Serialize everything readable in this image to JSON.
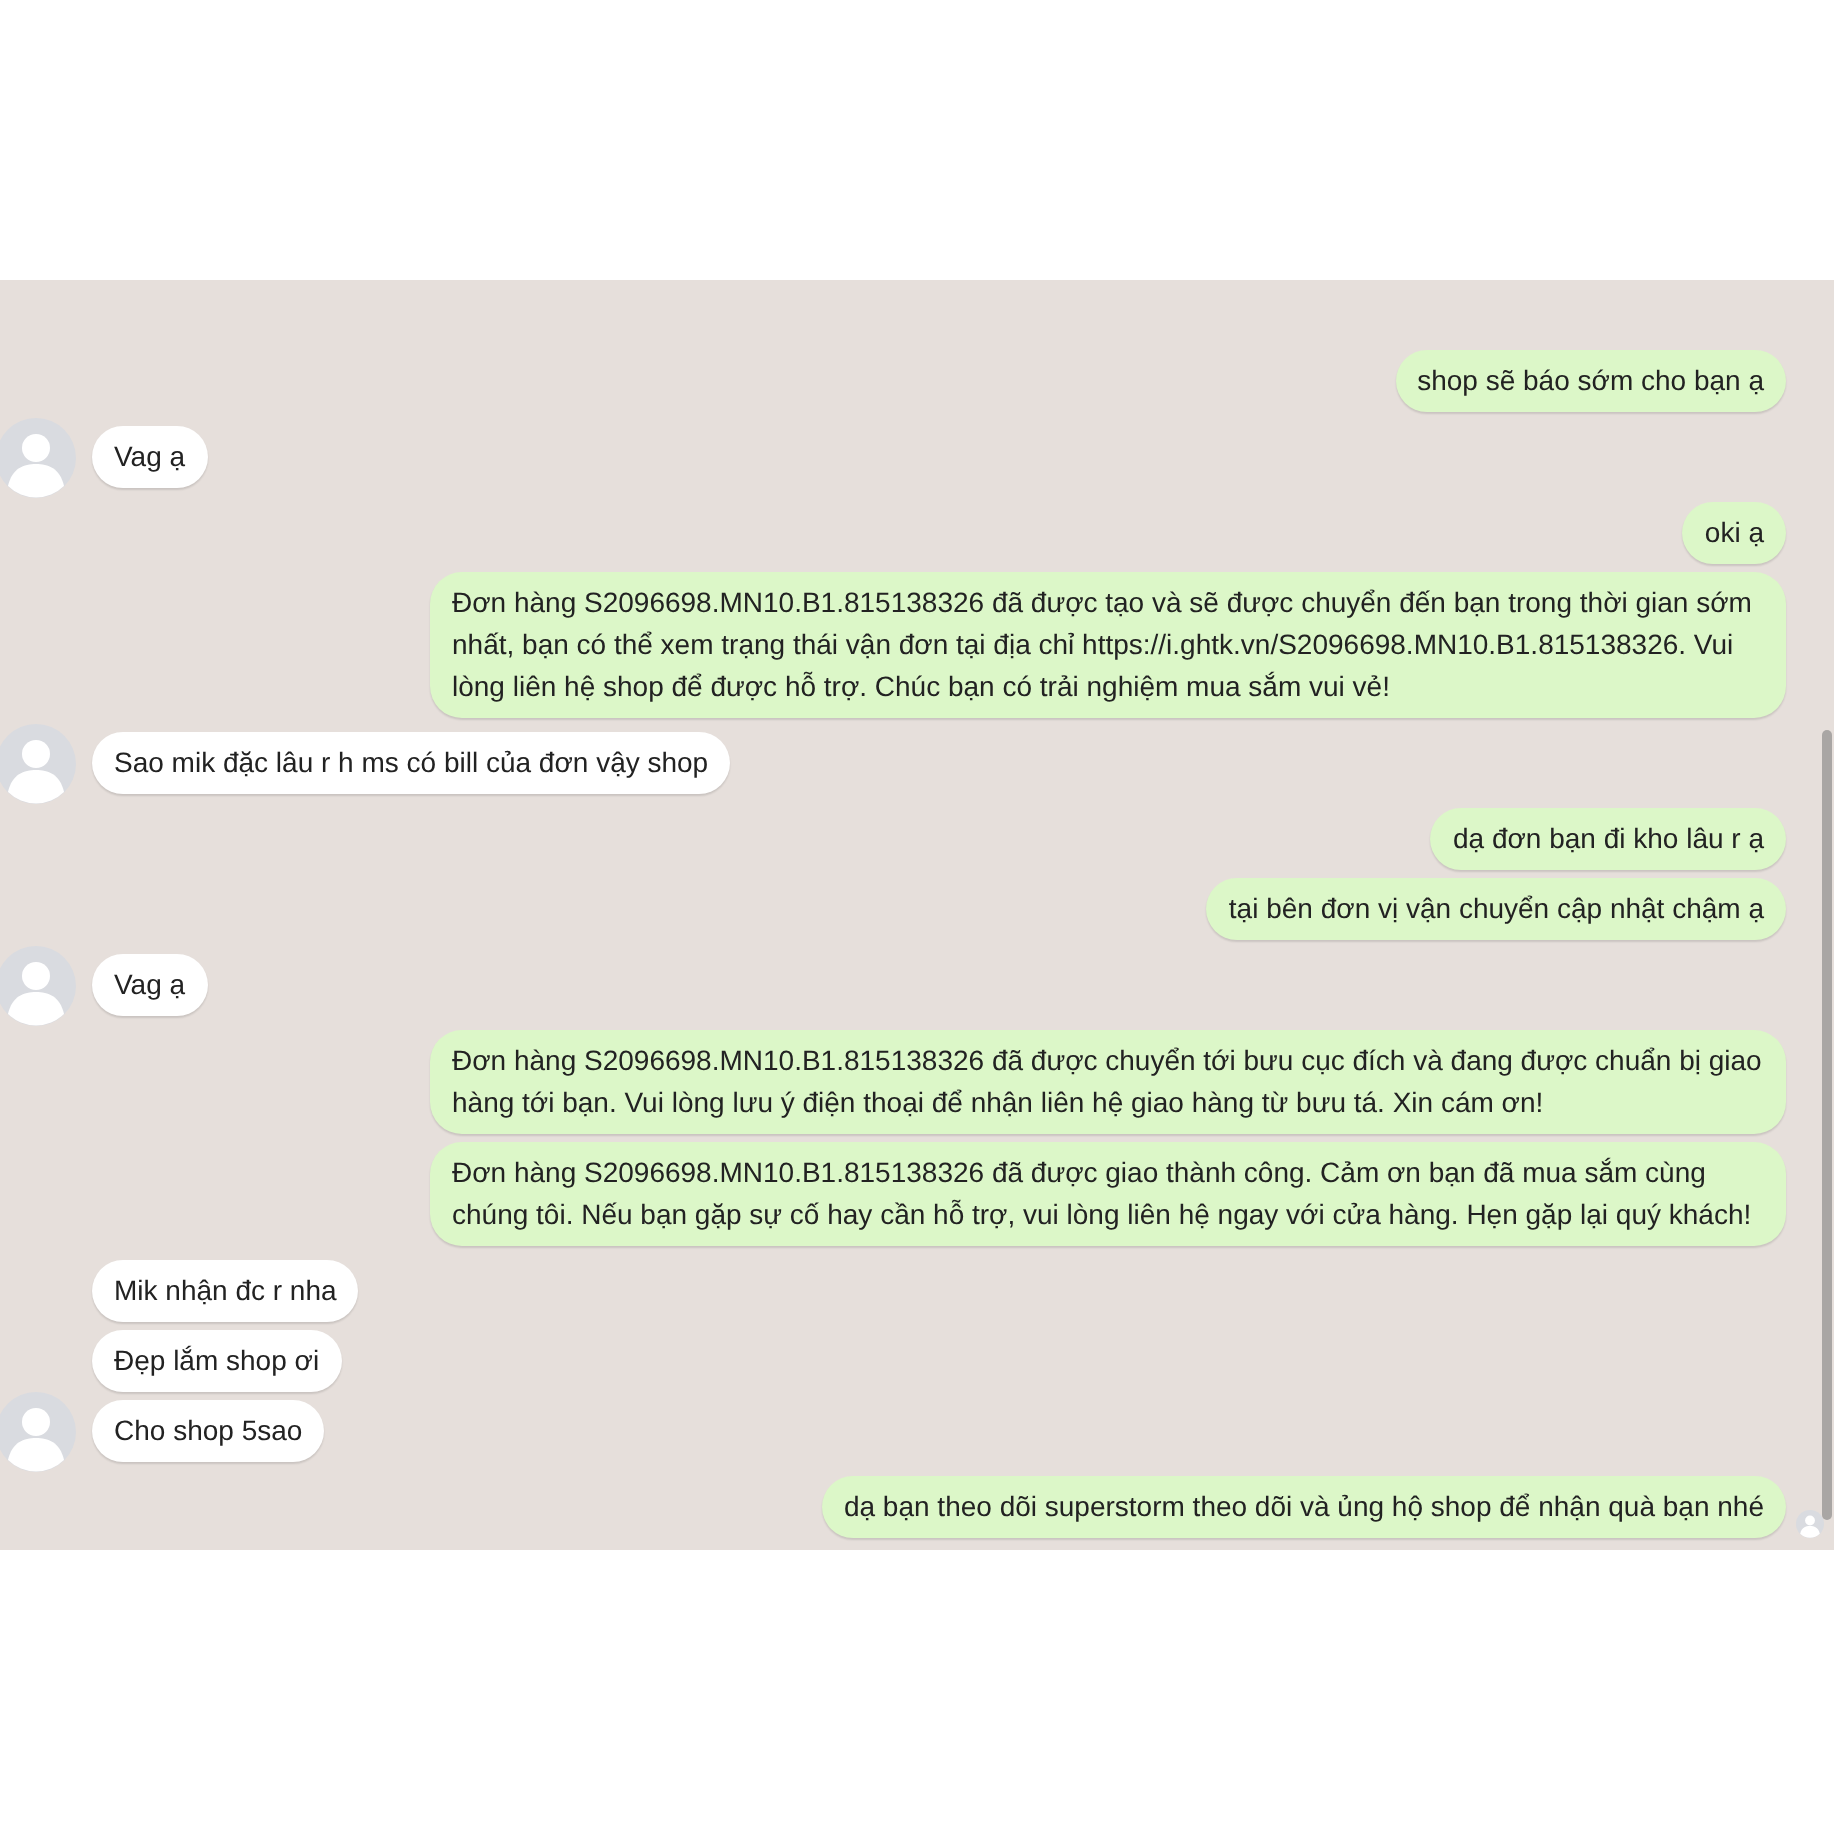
{
  "groups": [
    {
      "kind": "outgoing",
      "messages": [
        "shop sẽ báo sớm cho bạn ạ"
      ]
    },
    {
      "kind": "incoming",
      "messages": [
        "Vag ạ"
      ]
    },
    {
      "kind": "outgoing",
      "messages": [
        "oki ạ",
        "Đơn hàng S2096698.MN10.B1.815138326 đã được tạo và sẽ được chuyển đến bạn trong thời gian sớm nhất, bạn có thể xem trạng thái vận đơn tại địa chỉ https://i.ghtk.vn/S2096698.MN10.B1.815138326. Vui lòng liên hệ shop để được hỗ trợ. Chúc bạn có trải nghiệm mua sắm vui vẻ!"
      ]
    },
    {
      "kind": "incoming",
      "messages": [
        "Sao mik đặc lâu r h ms có bill của đơn vậy shop"
      ]
    },
    {
      "kind": "outgoing",
      "messages": [
        "dạ đơn bạn đi kho lâu r ạ",
        "tại bên đơn vị vận chuyển cập nhật chậm ạ"
      ]
    },
    {
      "kind": "incoming",
      "messages": [
        "Vag ạ"
      ]
    },
    {
      "kind": "outgoing",
      "messages": [
        "Đơn hàng S2096698.MN10.B1.815138326 đã được chuyển tới bưu cục đích và đang được chuẩn bị giao hàng tới bạn. Vui lòng lưu ý điện thoại để nhận liên hệ giao hàng từ bưu tá. Xin cám ơn!",
        "Đơn hàng S2096698.MN10.B1.815138326 đã được giao thành công. Cảm ơn bạn đã mua sắm cùng chúng tôi. Nếu bạn gặp sự cố hay cần hỗ trợ, vui lòng liên hệ ngay với cửa hàng. Hẹn gặp lại quý khách!"
      ]
    },
    {
      "kind": "incoming",
      "messages": [
        "Mik nhận đc r nha",
        "Đẹp lắm shop ơi",
        "Cho shop 5sao"
      ]
    },
    {
      "kind": "outgoing",
      "messages": [
        "dạ bạn theo dõi superstorm theo dõi và ủng hộ shop để nhận quà bạn nhé"
      ],
      "seen": true
    }
  ]
}
